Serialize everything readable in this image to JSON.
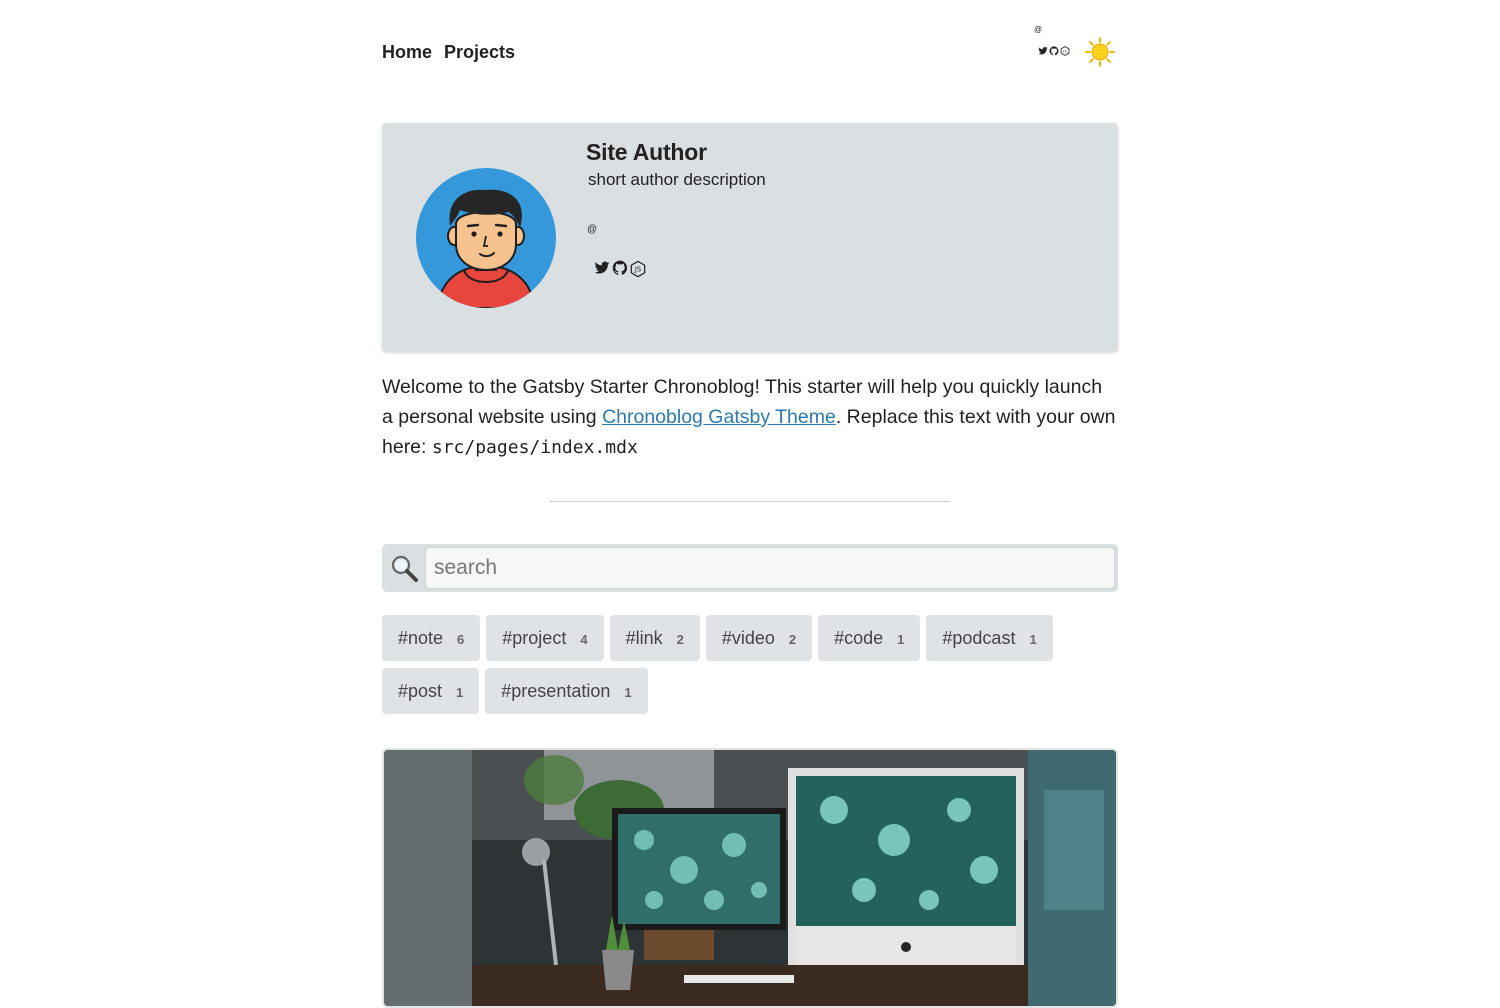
{
  "nav": {
    "items": [
      {
        "label": "Home"
      },
      {
        "label": "Projects"
      }
    ]
  },
  "header": {
    "at_symbol": "@",
    "social_icons": [
      "twitter-icon",
      "github-icon",
      "nodejs-icon"
    ],
    "theme_toggle_icon": "sun-icon"
  },
  "author": {
    "name": "Site Author",
    "description": "short author description",
    "at_symbol": "@",
    "social_icons": [
      "twitter-icon",
      "github-icon",
      "nodejs-icon"
    ],
    "avatar_icon": "avatar"
  },
  "intro": {
    "text_before": "Welcome to the Gatsby Starter Chronoblog! This starter will help you quickly launch a personal website using ",
    "link_label": "Chronoblog Gatsby Theme",
    "text_after": ". Replace this text with your own here: ",
    "code": "src/pages/index.mdx"
  },
  "search": {
    "placeholder": "search",
    "icon": "magnifier-icon"
  },
  "tags": [
    {
      "label": "#note",
      "count": "6"
    },
    {
      "label": "#project",
      "count": "4"
    },
    {
      "label": "#link",
      "count": "2"
    },
    {
      "label": "#video",
      "count": "2"
    },
    {
      "label": "#code",
      "count": "1"
    },
    {
      "label": "#podcast",
      "count": "1"
    },
    {
      "label": "#post",
      "count": "1"
    },
    {
      "label": "#presentation",
      "count": "1"
    }
  ],
  "colors": {
    "card_bg": "#dadfe1",
    "link": "#2a7ab0",
    "tag_bg": "#dfe3e6",
    "avatar_bg": "#3498db"
  }
}
